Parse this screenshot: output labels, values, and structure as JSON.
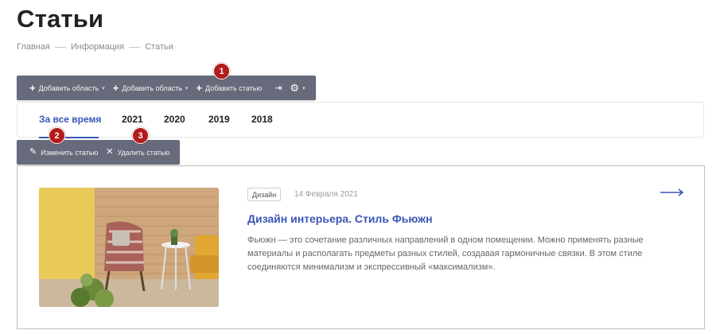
{
  "page": {
    "title": "Статьи"
  },
  "breadcrumb": [
    "Главная",
    "Информация",
    "Статьи"
  ],
  "toolbar_top": {
    "add_area_1": "Добавить область",
    "add_area_2": "Добавить область",
    "add_article": "Добавить статью"
  },
  "toolbar_item": {
    "edit": "Изменить статью",
    "delete": "Удалить статью"
  },
  "badges": [
    "1",
    "2",
    "3"
  ],
  "tabs": [
    {
      "label": "За все время",
      "active": true
    },
    {
      "label": "2021",
      "active": false
    },
    {
      "label": "2020",
      "active": false
    },
    {
      "label": "2019",
      "active": false
    },
    {
      "label": "2018",
      "active": false
    }
  ],
  "article": {
    "tag": "Дизайн",
    "date": "14 Февраля 2021",
    "title": "Дизайн интерьера. Стиль Фьюжн",
    "description": "Фьюжн — это сочетание различных направлений в одном помещении. Можно применять разные материалы и располагать предметы разных стилей, создавая гармоничные связки. В этом стиле соединяются минимализм и экспрессивный «максимализм».",
    "image": "interior-armchair-photo"
  },
  "colors": {
    "accent": "#3a56b5",
    "toolbar": "#676a7a",
    "badge": "#b31b1b"
  },
  "icons": [
    "plus-icon",
    "chevron-down-icon",
    "collapse-icon",
    "gear-icon",
    "pencil-icon",
    "close-icon",
    "arrow-right-icon",
    "drag-handle-icon"
  ]
}
